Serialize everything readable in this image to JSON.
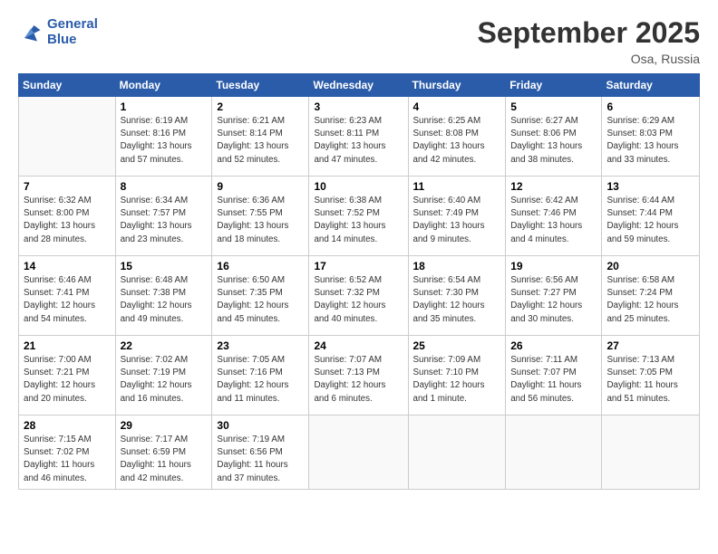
{
  "header": {
    "logo_line1": "General",
    "logo_line2": "Blue",
    "month": "September 2025",
    "location": "Osa, Russia"
  },
  "weekdays": [
    "Sunday",
    "Monday",
    "Tuesday",
    "Wednesday",
    "Thursday",
    "Friday",
    "Saturday"
  ],
  "weeks": [
    [
      {
        "num": "",
        "info": ""
      },
      {
        "num": "1",
        "info": "Sunrise: 6:19 AM\nSunset: 8:16 PM\nDaylight: 13 hours\nand 57 minutes."
      },
      {
        "num": "2",
        "info": "Sunrise: 6:21 AM\nSunset: 8:14 PM\nDaylight: 13 hours\nand 52 minutes."
      },
      {
        "num": "3",
        "info": "Sunrise: 6:23 AM\nSunset: 8:11 PM\nDaylight: 13 hours\nand 47 minutes."
      },
      {
        "num": "4",
        "info": "Sunrise: 6:25 AM\nSunset: 8:08 PM\nDaylight: 13 hours\nand 42 minutes."
      },
      {
        "num": "5",
        "info": "Sunrise: 6:27 AM\nSunset: 8:06 PM\nDaylight: 13 hours\nand 38 minutes."
      },
      {
        "num": "6",
        "info": "Sunrise: 6:29 AM\nSunset: 8:03 PM\nDaylight: 13 hours\nand 33 minutes."
      }
    ],
    [
      {
        "num": "7",
        "info": "Sunrise: 6:32 AM\nSunset: 8:00 PM\nDaylight: 13 hours\nand 28 minutes."
      },
      {
        "num": "8",
        "info": "Sunrise: 6:34 AM\nSunset: 7:57 PM\nDaylight: 13 hours\nand 23 minutes."
      },
      {
        "num": "9",
        "info": "Sunrise: 6:36 AM\nSunset: 7:55 PM\nDaylight: 13 hours\nand 18 minutes."
      },
      {
        "num": "10",
        "info": "Sunrise: 6:38 AM\nSunset: 7:52 PM\nDaylight: 13 hours\nand 14 minutes."
      },
      {
        "num": "11",
        "info": "Sunrise: 6:40 AM\nSunset: 7:49 PM\nDaylight: 13 hours\nand 9 minutes."
      },
      {
        "num": "12",
        "info": "Sunrise: 6:42 AM\nSunset: 7:46 PM\nDaylight: 13 hours\nand 4 minutes."
      },
      {
        "num": "13",
        "info": "Sunrise: 6:44 AM\nSunset: 7:44 PM\nDaylight: 12 hours\nand 59 minutes."
      }
    ],
    [
      {
        "num": "14",
        "info": "Sunrise: 6:46 AM\nSunset: 7:41 PM\nDaylight: 12 hours\nand 54 minutes."
      },
      {
        "num": "15",
        "info": "Sunrise: 6:48 AM\nSunset: 7:38 PM\nDaylight: 12 hours\nand 49 minutes."
      },
      {
        "num": "16",
        "info": "Sunrise: 6:50 AM\nSunset: 7:35 PM\nDaylight: 12 hours\nand 45 minutes."
      },
      {
        "num": "17",
        "info": "Sunrise: 6:52 AM\nSunset: 7:32 PM\nDaylight: 12 hours\nand 40 minutes."
      },
      {
        "num": "18",
        "info": "Sunrise: 6:54 AM\nSunset: 7:30 PM\nDaylight: 12 hours\nand 35 minutes."
      },
      {
        "num": "19",
        "info": "Sunrise: 6:56 AM\nSunset: 7:27 PM\nDaylight: 12 hours\nand 30 minutes."
      },
      {
        "num": "20",
        "info": "Sunrise: 6:58 AM\nSunset: 7:24 PM\nDaylight: 12 hours\nand 25 minutes."
      }
    ],
    [
      {
        "num": "21",
        "info": "Sunrise: 7:00 AM\nSunset: 7:21 PM\nDaylight: 12 hours\nand 20 minutes."
      },
      {
        "num": "22",
        "info": "Sunrise: 7:02 AM\nSunset: 7:19 PM\nDaylight: 12 hours\nand 16 minutes."
      },
      {
        "num": "23",
        "info": "Sunrise: 7:05 AM\nSunset: 7:16 PM\nDaylight: 12 hours\nand 11 minutes."
      },
      {
        "num": "24",
        "info": "Sunrise: 7:07 AM\nSunset: 7:13 PM\nDaylight: 12 hours\nand 6 minutes."
      },
      {
        "num": "25",
        "info": "Sunrise: 7:09 AM\nSunset: 7:10 PM\nDaylight: 12 hours\nand 1 minute."
      },
      {
        "num": "26",
        "info": "Sunrise: 7:11 AM\nSunset: 7:07 PM\nDaylight: 11 hours\nand 56 minutes."
      },
      {
        "num": "27",
        "info": "Sunrise: 7:13 AM\nSunset: 7:05 PM\nDaylight: 11 hours\nand 51 minutes."
      }
    ],
    [
      {
        "num": "28",
        "info": "Sunrise: 7:15 AM\nSunset: 7:02 PM\nDaylight: 11 hours\nand 46 minutes."
      },
      {
        "num": "29",
        "info": "Sunrise: 7:17 AM\nSunset: 6:59 PM\nDaylight: 11 hours\nand 42 minutes."
      },
      {
        "num": "30",
        "info": "Sunrise: 7:19 AM\nSunset: 6:56 PM\nDaylight: 11 hours\nand 37 minutes."
      },
      {
        "num": "",
        "info": ""
      },
      {
        "num": "",
        "info": ""
      },
      {
        "num": "",
        "info": ""
      },
      {
        "num": "",
        "info": ""
      }
    ]
  ]
}
